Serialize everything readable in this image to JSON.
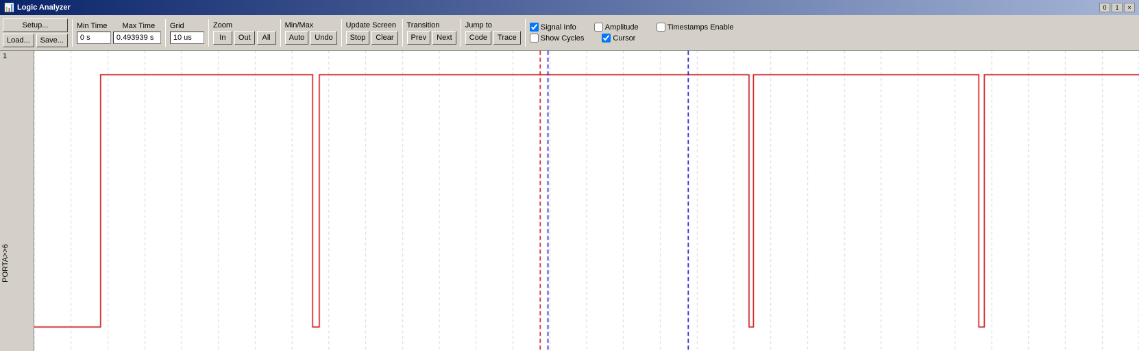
{
  "titleBar": {
    "title": "Logic Analyzer",
    "controls": {
      "minimize": "0",
      "restore": "1",
      "close": "×"
    }
  },
  "toolbar": {
    "setup_label": "Setup...",
    "load_label": "Load...",
    "save_label": "Save...",
    "min_time_label": "Min Time",
    "min_time_value": "0 s",
    "max_time_label": "Max Time",
    "max_time_value": "0.493939 s",
    "grid_label": "Grid",
    "grid_value": "10 us",
    "zoom_label": "Zoom",
    "zoom_in_label": "In",
    "zoom_out_label": "Out",
    "zoom_all_label": "All",
    "minmax_label": "Min/Max",
    "minmax_auto_label": "Auto",
    "minmax_undo_label": "Undo",
    "update_screen_label": "Update Screen",
    "update_stop_label": "Stop",
    "update_clear_label": "Clear",
    "transition_label": "Transition",
    "transition_prev_label": "Prev",
    "transition_next_label": "Next",
    "jump_to_label": "Jump to",
    "jump_code_label": "Code",
    "jump_trace_label": "Trace",
    "signal_info_label": "Signal Info",
    "signal_info_checked": true,
    "amplitude_label": "Amplitude",
    "amplitude_checked": false,
    "timestamps_enable_label": "Timestamps Enable",
    "timestamps_checked": false,
    "show_cycles_label": "Show Cycles",
    "show_cycles_checked": false,
    "cursor_label": "Cursor",
    "cursor_checked": true
  },
  "signalArea": {
    "row_number": "1",
    "signal_name": "PORTA>>6"
  },
  "waveform": {
    "grid_count": 30,
    "red_line1_x": 0.048,
    "red_line2_x": 0.255,
    "red_line3_x": 0.458,
    "red_line4_x": 0.647,
    "red_line5_x": 0.648,
    "red_line6_x": 0.664,
    "red_line7_x": 0.855,
    "red_cursor_x": 0.838,
    "blue_cursor1_x": 0.458,
    "blue_cursor2_x": 0.592
  }
}
